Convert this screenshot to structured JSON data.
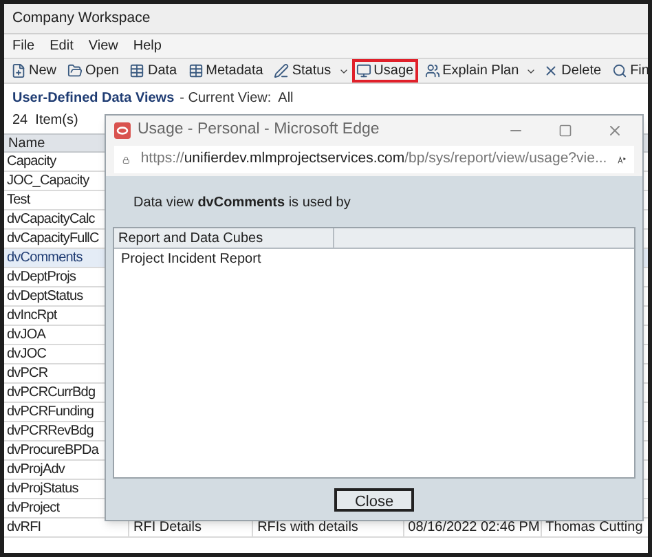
{
  "window": {
    "title": "Company Workspace"
  },
  "menu": [
    "File",
    "Edit",
    "View",
    "Help"
  ],
  "toolbar": [
    {
      "label": "New",
      "kind": "new",
      "highlighted": false,
      "dropdown": false
    },
    {
      "label": "Open",
      "kind": "open",
      "highlighted": false,
      "dropdown": false
    },
    {
      "label": "Data",
      "kind": "table",
      "highlighted": false,
      "dropdown": false
    },
    {
      "label": "Metadata",
      "kind": "table",
      "highlighted": false,
      "dropdown": false
    },
    {
      "label": "Status",
      "kind": "status",
      "highlighted": false,
      "dropdown": true
    },
    {
      "label": "Usage",
      "kind": "usage",
      "highlighted": true,
      "dropdown": false
    },
    {
      "label": "Explain Plan",
      "kind": "plan",
      "highlighted": false,
      "dropdown": true
    },
    {
      "label": "Delete",
      "kind": "delete",
      "highlighted": false,
      "dropdown": false
    },
    {
      "label": "Fin",
      "kind": "find",
      "highlighted": false,
      "dropdown": false
    }
  ],
  "heading": {
    "title": "User-Defined Data Views",
    "view": "- Current View:  All"
  },
  "count": "24  Item(s)",
  "table": {
    "columns": [
      "Name"
    ],
    "rows": [
      {
        "name": "Capacity",
        "selected": false
      },
      {
        "name": "JOC_Capacity",
        "selected": false
      },
      {
        "name": "Test",
        "selected": false
      },
      {
        "name": "dvCapacityCalc",
        "selected": false
      },
      {
        "name": "dvCapacityFullC",
        "selected": false
      },
      {
        "name": "dvComments",
        "selected": true
      },
      {
        "name": "dvDeptProjs",
        "selected": false
      },
      {
        "name": "dvDeptStatus",
        "selected": false
      },
      {
        "name": "dvIncRpt",
        "selected": false
      },
      {
        "name": "dvJOA",
        "selected": false
      },
      {
        "name": "dvJOC",
        "selected": false
      },
      {
        "name": "dvPCR",
        "selected": false
      },
      {
        "name": "dvPCRCurrBdg",
        "selected": false
      },
      {
        "name": "dvPCRFunding",
        "selected": false
      },
      {
        "name": "dvPCRRevBdg",
        "selected": false
      },
      {
        "name": "dvProcureBPDa",
        "selected": false
      },
      {
        "name": "dvProjAdv",
        "selected": false
      },
      {
        "name": "dvProjStatus",
        "selected": false
      },
      {
        "name": "dvProject",
        "selected": false
      },
      {
        "name": "dvRFI",
        "selected": false,
        "cells": [
          "RFI Details",
          "RFIs with details",
          "08/16/2022 02:46 PM",
          "Thomas Cutting"
        ]
      }
    ]
  },
  "dialog": {
    "title": "Usage - Personal - Microsoft Edge",
    "url_prefix": "https://",
    "url_host": "unifierdev.mlmprojectservices.com",
    "url_path": "/bp/sys/report/view/usage?vie...",
    "message": "Data view **dvComments** is used by",
    "columns": [
      "Report and Data Cubes"
    ],
    "rows": [
      "Project Incident Report"
    ],
    "button": "Close"
  }
}
